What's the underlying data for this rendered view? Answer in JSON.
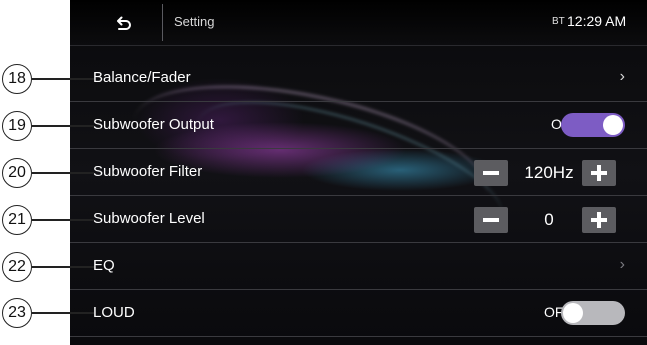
{
  "header": {
    "title": "Setting",
    "bt": "BT",
    "time": "12:29 AM"
  },
  "rows": [
    {
      "callout": "18",
      "label": "Balance/Fader",
      "chevron": "›"
    },
    {
      "callout": "19",
      "label": "Subwoofer Output",
      "toggle_text": "ON",
      "toggle_state": "on"
    },
    {
      "callout": "20",
      "label": "Subwoofer Filter",
      "value": "120Hz"
    },
    {
      "callout": "21",
      "label": "Subwoofer Level",
      "value": "0"
    },
    {
      "callout": "22",
      "label": "EQ",
      "chevron": "›"
    },
    {
      "callout": "23",
      "label": "LOUD",
      "toggle_text": "OFF",
      "toggle_state": "off"
    }
  ],
  "colors": {
    "accent": "#7d5cc4",
    "background": "#0d0d10",
    "divider": "#3a3a3f",
    "button": "#5c5c60"
  },
  "icons": {
    "back": "back-arrow-icon",
    "chevron": "chevron-right-icon",
    "minus": "minus-icon",
    "plus": "plus-icon"
  }
}
